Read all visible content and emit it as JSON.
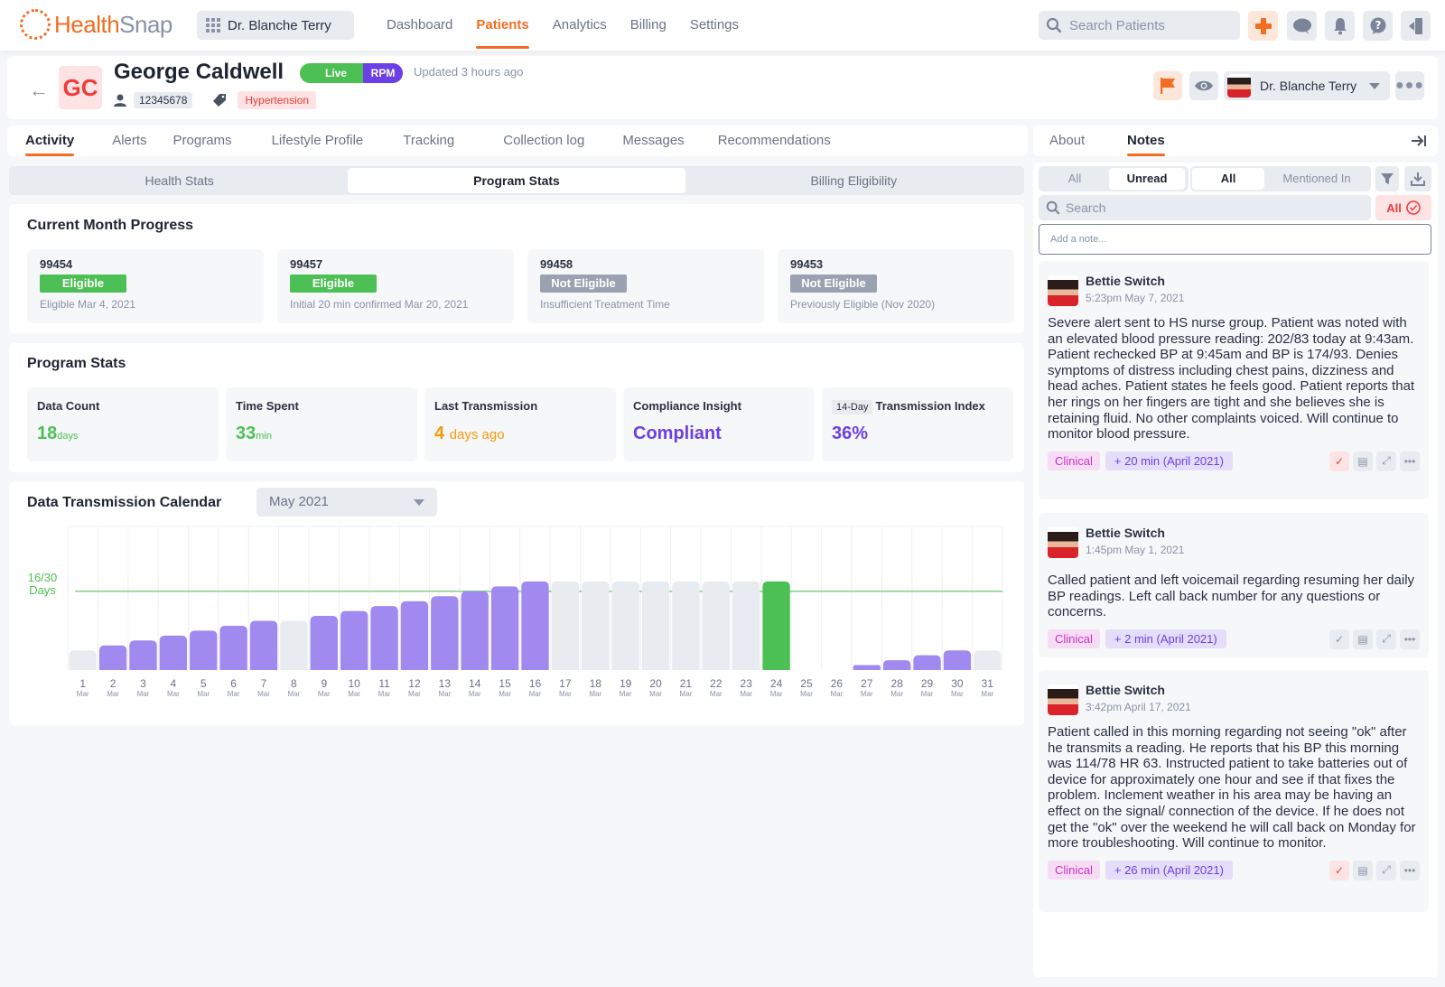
{
  "brand": {
    "name_part1": "Health",
    "name_part2": "Snap"
  },
  "org_selector": {
    "label": "Dr. Blanche Terry"
  },
  "nav": [
    {
      "label": "Dashboard",
      "active": false
    },
    {
      "label": "Patients",
      "active": true
    },
    {
      "label": "Analytics",
      "active": false
    },
    {
      "label": "Billing",
      "active": false
    },
    {
      "label": "Settings",
      "active": false
    }
  ],
  "top_search": {
    "placeholder": "Search Patients"
  },
  "top_icons": [
    "plus-icon",
    "chat-icon",
    "bell-icon",
    "help-icon",
    "logout-icon"
  ],
  "patient": {
    "initials": "GC",
    "name": "George Caldwell",
    "status_live": "Live",
    "program": "RPM",
    "updated": "Updated 3 hours ago",
    "id": "12345678",
    "condition_tag": "Hypertension",
    "assigned_provider": "Dr. Blanche Terry"
  },
  "main_tabs": [
    {
      "label": "Activity",
      "active": true
    },
    {
      "label": "Alerts",
      "active": false
    },
    {
      "label": "Programs",
      "active": false
    },
    {
      "label": "Lifestyle Profile",
      "active": false
    },
    {
      "label": "Tracking",
      "active": false
    },
    {
      "label": "Collection log",
      "active": false
    },
    {
      "label": "Messages",
      "active": false
    },
    {
      "label": "Recommendations",
      "active": false
    }
  ],
  "sub_tabs": [
    {
      "label": "Health Stats",
      "active": false
    },
    {
      "label": "Program Stats",
      "active": true
    },
    {
      "label": "Billing Eligibility",
      "active": false
    }
  ],
  "current_month": {
    "title": "Current Month Progress",
    "items": [
      {
        "code": "99454",
        "status": "Eligible",
        "eligible": true,
        "detail": "Eligible Mar 4, 2021"
      },
      {
        "code": "99457",
        "status": "Eligible",
        "eligible": true,
        "detail": "Initial 20 min confirmed Mar 20, 2021"
      },
      {
        "code": "99458",
        "status": "Not Eligible",
        "eligible": false,
        "detail": "Insufficient Treatment Time"
      },
      {
        "code": "99453",
        "status": "Not Eligible",
        "eligible": false,
        "detail": "Previously Eligible (Nov 2020)"
      }
    ]
  },
  "program_stats": {
    "title": "Program Stats",
    "data_count": {
      "label": "Data Count",
      "value": "18",
      "unit": "days"
    },
    "time_spent": {
      "label": "Time Spent",
      "value": "33",
      "unit": "min"
    },
    "last_transmission": {
      "label": "Last Transmission",
      "value": "4",
      "unit": "days ago"
    },
    "compliance": {
      "label": "Compliance Insight",
      "value": "Compliant"
    },
    "transmission_index": {
      "period": "14-Day",
      "label": "Transmission Index",
      "value": "36%"
    }
  },
  "calendar": {
    "title": "Data Transmission Calendar",
    "month_selected": "May 2021"
  },
  "chart_data": {
    "type": "bar",
    "title": "Data Transmission Calendar",
    "xlabel": "",
    "ylabel": "",
    "categories": [
      "1",
      "2",
      "3",
      "4",
      "5",
      "6",
      "7",
      "8",
      "9",
      "10",
      "11",
      "12",
      "13",
      "14",
      "15",
      "16",
      "17",
      "18",
      "19",
      "20",
      "21",
      "22",
      "23",
      "24",
      "25",
      "26",
      "27",
      "28",
      "29",
      "30",
      "31"
    ],
    "category_sublabel": "Mar",
    "values": [
      4,
      5,
      6,
      7,
      8,
      9,
      10,
      10,
      11,
      12,
      13,
      14,
      15,
      16,
      17,
      18,
      18,
      18,
      18,
      18,
      18,
      18,
      18,
      18,
      0,
      0,
      1,
      2,
      3,
      4,
      4
    ],
    "status": [
      "none",
      "transmitted",
      "transmitted",
      "transmitted",
      "transmitted",
      "transmitted",
      "transmitted",
      "none",
      "transmitted",
      "transmitted",
      "transmitted",
      "transmitted",
      "transmitted",
      "transmitted",
      "transmitted",
      "transmitted",
      "none",
      "none",
      "none",
      "none",
      "none",
      "none",
      "none",
      "today",
      "none",
      "none",
      "transmitted",
      "transmitted",
      "transmitted",
      "transmitted",
      "none"
    ],
    "status_colors": {
      "transmitted": "#a08af0",
      "none": "#e8ebef",
      "today": "#4cbf55"
    },
    "threshold": {
      "value": 16,
      "label_line1": "16/30",
      "label_line2": "Days",
      "color": "#7fd088"
    },
    "ylim": [
      0,
      30
    ],
    "grid": true
  },
  "notes_panel": {
    "tabs": [
      {
        "label": "About",
        "active": false
      },
      {
        "label": "Notes",
        "active": true
      }
    ],
    "read_filter": [
      {
        "label": "All",
        "active": false
      },
      {
        "label": "Unread",
        "active": true
      }
    ],
    "mention_filter": [
      {
        "label": "All",
        "active": true
      },
      {
        "label": "Mentioned In",
        "active": false
      }
    ],
    "search_placeholder": "Search",
    "status_filter": "All",
    "add_note_placeholder": "Add a note...",
    "notes": [
      {
        "author": "Bettie Switch",
        "time": "5:23pm May 7, 2021",
        "body": "Severe alert sent to HS nurse group. Patient was noted with an elevated blood pressure reading: 202/83 today at 9:43am. Patient rechecked BP at 9:45am and BP is 174/93. Denies symptoms of distress including chest pains, dizziness and head aches. Patient states he feels good. Patient reports that her rings on her fingers are tight and she believes she is retaining fluid. No other complaints voiced. Will continue to monitor blood pressure.",
        "category": "Clinical",
        "time_added": "+ 20 min (April 2021)",
        "resolved": true
      },
      {
        "author": "Bettie Switch",
        "time": "1:45pm May 1, 2021",
        "body": "Called patient and left voicemail regarding resuming her daily BP readings. Left call back number for any questions or concerns.",
        "category": "Clinical",
        "time_added": "+ 2 min (April 2021)",
        "resolved": false
      },
      {
        "author": "Bettie Switch",
        "time": "3:42pm April 17, 2021",
        "body": "Patient called in this morning regarding not seeing \"ok\" after he transmits a reading. He reports that his BP this morning was 114/78 HR 63. Instructed patient to take batteries out of device for approximately one hour and see if that fixes the problem. Inclement weather in his area may be having an effect on the signal/ connection of the device. If he does not get the \"ok\" over the weekend he will call back on Monday for more troubleshooting. Will continue to monitor.",
        "category": "Clinical",
        "time_added": "+ 26 min (April 2021)",
        "resolved": true
      }
    ]
  }
}
